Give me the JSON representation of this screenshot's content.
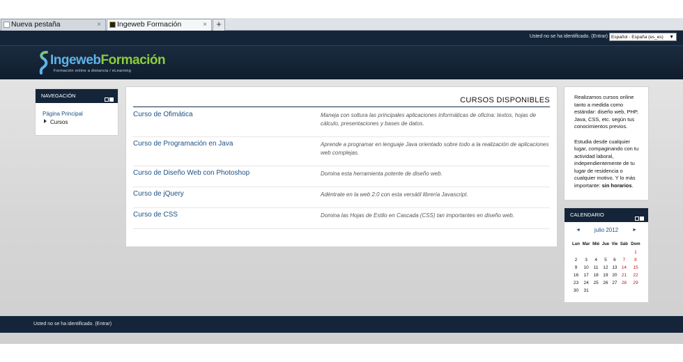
{
  "browser": {
    "tabs": [
      {
        "label": "Nueva pestaña",
        "close": "×"
      },
      {
        "label": "Ingeweb Formación",
        "close": "×"
      }
    ],
    "new_tab": "+"
  },
  "topbar": {
    "login_text": "Usted no se ha identificado.",
    "login_link": "(Entrar)",
    "language": "Español - España (es_es)"
  },
  "header": {
    "logo_part1": "Ingeweb",
    "logo_part2": "Formación",
    "tagline": "Formación online a distancia / eLearning"
  },
  "navigation": {
    "title": "NAVEGACIÓN",
    "home": "Página Principal",
    "courses": "Cursos"
  },
  "main": {
    "title": "CURSOS DISPONIBLES",
    "courses": [
      {
        "name": "Curso de Ofimática",
        "desc": "Maneja con soltura las principales aplicaciones informáticas de oficina: textos, hojas de cálculo, presentaciones y bases de datos."
      },
      {
        "name": "Curso de Programación en Java",
        "desc": "Aprende a programar en lenguaje Java orientado sobre todo a la realización de aplicaciones web complejas."
      },
      {
        "name": "Curso de Diseño Web con Photoshop",
        "desc": "Domina esta herramienta potente de diseño web."
      },
      {
        "name": "Curso de jQuery",
        "desc": "Adéntrate en la web 2.0 con esta versátil librería Javascript."
      },
      {
        "name": "Curso de CSS",
        "desc": "Domina las Hojas de Estilo en Cascada (CSS) tan importantes en diseño web."
      }
    ]
  },
  "about": {
    "p1": "Realizamos cursos online tanto a medida como estándar: diseño web, PHP, Java, CSS, etc. según tus conocimientos previos.",
    "p2": "Estudia desde cualquier lugar, compaginando con tu actividad laboral, independientemente de tu lugar de residencia o cualquier motivo. Y lo más importante:",
    "p2_bold": "sin horarios"
  },
  "calendar": {
    "title": "CALENDARIO",
    "month": "julio 2012",
    "prev": "◄",
    "next": "►",
    "weekdays": [
      "Lun",
      "Mar",
      "Mié",
      "Jue",
      "Vie",
      "Sáb",
      "Dom"
    ],
    "weeks": [
      [
        "",
        "",
        "",
        "",
        "",
        "",
        "1"
      ],
      [
        "2",
        "3",
        "4",
        "5",
        "6",
        "7",
        "8"
      ],
      [
        "9",
        "10",
        "11",
        "12",
        "13",
        "14",
        "15"
      ],
      [
        "16",
        "17",
        "18",
        "19",
        "20",
        "21",
        "22"
      ],
      [
        "23",
        "24",
        "25",
        "26",
        "27",
        "28",
        "29"
      ],
      [
        "30",
        "31",
        "",
        "",
        "",
        "",
        ""
      ]
    ]
  },
  "footer": {
    "login_text": "Usted no se ha identificado. (Entrar)"
  }
}
